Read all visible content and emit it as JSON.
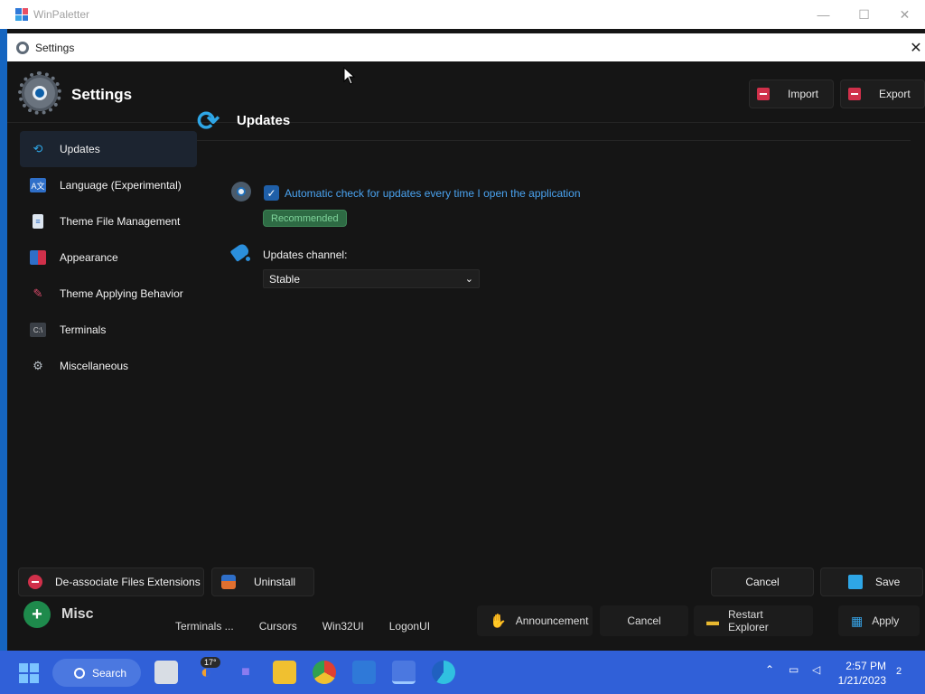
{
  "main_window": {
    "title": "WinPaletter",
    "controls": {
      "minimize": "—",
      "maximize": "☐",
      "close": "✕"
    },
    "misc_label": "Misc",
    "bottom_tabs": [
      "Terminals ...",
      "Cursors",
      "Win32UI",
      "LogonUI"
    ],
    "bottom_actions": {
      "announcement": "Announcement",
      "cancel": "Cancel",
      "restart_explorer": "Restart Explorer",
      "apply": "Apply"
    }
  },
  "dialog": {
    "title": "Settings",
    "close": "✕",
    "header": {
      "title": "Settings",
      "import": "Import",
      "export": "Export"
    },
    "sidebar": {
      "items": [
        {
          "label": "Updates",
          "icon": "refresh-icon",
          "active": true
        },
        {
          "label": "Language (Experimental)",
          "icon": "language-icon"
        },
        {
          "label": "Theme File Management",
          "icon": "file-icon"
        },
        {
          "label": "Appearance",
          "icon": "appearance-icon"
        },
        {
          "label": "Theme Applying Behavior",
          "icon": "brush-icon"
        },
        {
          "label": "Terminals",
          "icon": "terminal-icon"
        },
        {
          "label": "Miscellaneous",
          "icon": "gears-icon"
        }
      ]
    },
    "content": {
      "title": "Updates",
      "auto_check_label": "Automatic check for updates every time I open the application",
      "auto_check_checked": true,
      "recommended_badge": "Recommended",
      "channel_label": "Updates channel:",
      "channel_value": "Stable"
    },
    "footer": {
      "deassociate": "De-associate Files Extensions",
      "uninstall": "Uninstall",
      "cancel": "Cancel",
      "save": "Save"
    }
  },
  "taskbar": {
    "search_label": "Search",
    "weather_badge": "17°",
    "time": "2:57 PM",
    "date": "1/21/2023",
    "notification_count": "2"
  },
  "colors": {
    "accent_blue": "#2ea6e6",
    "link_blue": "#4aa3f0",
    "recommended_green": "#7fd49b",
    "taskbar_blue": "#3060d8"
  }
}
